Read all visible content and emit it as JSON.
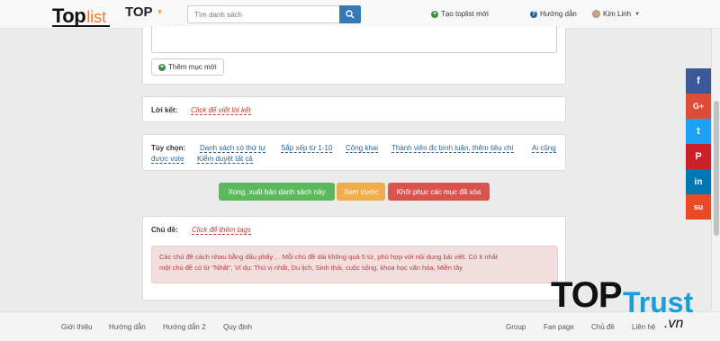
{
  "navbar": {
    "logo_top": "Top",
    "logo_list": "list",
    "menu_label": "TOP",
    "search_placeholder": "Tìm danh sách",
    "create_label": "Tạo toplist mới",
    "guide_label": "Hướng dẫn",
    "user_name": "Kim Linh"
  },
  "items_panel": {
    "add_item_label": "Thêm mục mới"
  },
  "conclusion": {
    "label": "Lời kết:",
    "link": "Click để viết lời kết"
  },
  "options": {
    "label": "Tùy chọn:",
    "items": [
      "Danh sách có thứ tự",
      "Sắp xếp từ 1-10",
      "Công khai",
      "Thành viên đc bình luận, thêm tiêu chí",
      "Ai cũng",
      "được vote",
      "Kiểm duyệt tất cả"
    ]
  },
  "actions": {
    "publish": "Xong, xuất bản danh sách này",
    "preview": "Xem trước",
    "restore": "Khôi phục các mục đã xóa"
  },
  "topics": {
    "label": "Chủ đề:",
    "link": "Click để thêm tags",
    "alert_line1": "Các chủ đề cách nhau bằng dấu phẩy , . Mỗi chủ đề dài không quá 5 từ, phù hợp với nội dung bài viết. Có ít nhất",
    "alert_line2": "một chủ đề có từ \"Nhất\", Ví dụ: Thú vị nhất, Du lịch, Sinh thái, cuộc sống, khoa học văn hóa, Miền tây"
  },
  "footer": {
    "left": [
      "Giới thiệu",
      "Hướng dẫn",
      "Hướng dẫn 2",
      "Quy định"
    ],
    "right": [
      "Group",
      "Fan page",
      "Chủ đề",
      "Liên hệ"
    ]
  },
  "social": [
    {
      "icon": "facebook-icon",
      "glyph": "f",
      "color": "#3b5998"
    },
    {
      "icon": "google-plus-icon",
      "glyph": "G+",
      "color": "#dd4b39"
    },
    {
      "icon": "twitter-icon",
      "glyph": "t",
      "color": "#1da1f2"
    },
    {
      "icon": "pinterest-icon",
      "glyph": "P",
      "color": "#cb2027"
    },
    {
      "icon": "linkedin-icon",
      "glyph": "in",
      "color": "#0077b5"
    },
    {
      "icon": "stumbleupon-icon",
      "glyph": "su",
      "color": "#eb4924"
    }
  ],
  "watermark": {
    "top": "TOP",
    "trust": "Trust",
    "vn": ".vn"
  },
  "colors": {
    "primary": "#337ab7",
    "success": "#5cb85c",
    "warning": "#f0ad4e",
    "danger": "#d9534f",
    "brand_orange": "#f07b24"
  }
}
